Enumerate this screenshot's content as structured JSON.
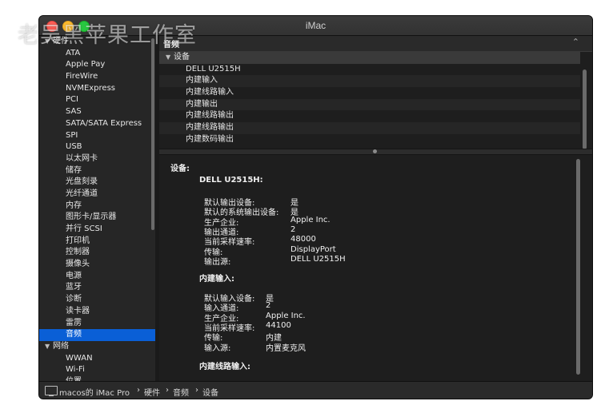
{
  "window": {
    "title": "iMac"
  },
  "watermark": "老吴黑苹果工作室",
  "sidebar": {
    "items": [
      {
        "label": "硬件",
        "section": true
      },
      {
        "label": "ATA"
      },
      {
        "label": "Apple Pay"
      },
      {
        "label": "FireWire"
      },
      {
        "label": "NVMExpress"
      },
      {
        "label": "PCI"
      },
      {
        "label": "SAS"
      },
      {
        "label": "SATA/SATA Express"
      },
      {
        "label": "SPI"
      },
      {
        "label": "USB"
      },
      {
        "label": "以太网卡"
      },
      {
        "label": "储存"
      },
      {
        "label": "光盘刻录"
      },
      {
        "label": "光纤通道"
      },
      {
        "label": "内存"
      },
      {
        "label": "图形卡/显示器"
      },
      {
        "label": "并行 SCSI"
      },
      {
        "label": "打印机"
      },
      {
        "label": "控制器"
      },
      {
        "label": "摄像头"
      },
      {
        "label": "电源"
      },
      {
        "label": "蓝牙"
      },
      {
        "label": "诊断"
      },
      {
        "label": "读卡器"
      },
      {
        "label": "雷雳"
      },
      {
        "label": "音频",
        "selected": true
      },
      {
        "label": "网络",
        "section": true
      },
      {
        "label": "WWAN"
      },
      {
        "label": "Wi-Fi"
      },
      {
        "label": "位置"
      }
    ]
  },
  "right": {
    "header": "音频",
    "tree": {
      "root": "设备",
      "children": [
        "DELL U2515H",
        "内建输入",
        "内建线路输入",
        "内建输出",
        "内建线路输出",
        "内建线路输出",
        "内建数码输出"
      ]
    },
    "detail": {
      "label": "设备:",
      "devices": [
        {
          "name": "DELL U2515H:",
          "rows": [
            {
              "k": "默认输出设备:",
              "v": "是"
            },
            {
              "k": "默认的系统输出设备:",
              "v": "是"
            },
            {
              "k": "生产企业:",
              "v": "Apple Inc."
            },
            {
              "k": "输出通道:",
              "v": "2"
            },
            {
              "k": "当前采样速率:",
              "v": "48000"
            },
            {
              "k": "传输:",
              "v": "DisplayPort"
            },
            {
              "k": "输出源:",
              "v": "DELL U2515H"
            }
          ]
        },
        {
          "name": "内建输入:",
          "rows": [
            {
              "k": "默认输入设备:",
              "v": "是"
            },
            {
              "k": "输入通道:",
              "v": "2"
            },
            {
              "k": "生产企业:",
              "v": "Apple Inc."
            },
            {
              "k": "当前采样速率:",
              "v": "44100"
            },
            {
              "k": "传输:",
              "v": "内建"
            },
            {
              "k": "输入源:",
              "v": "内置麦克风"
            }
          ]
        },
        {
          "name": "内建线路输入:",
          "rows": []
        }
      ]
    }
  },
  "statusbar": {
    "crumbs": [
      "macos的 iMac Pro",
      "硬件",
      "音频",
      "设备"
    ]
  }
}
